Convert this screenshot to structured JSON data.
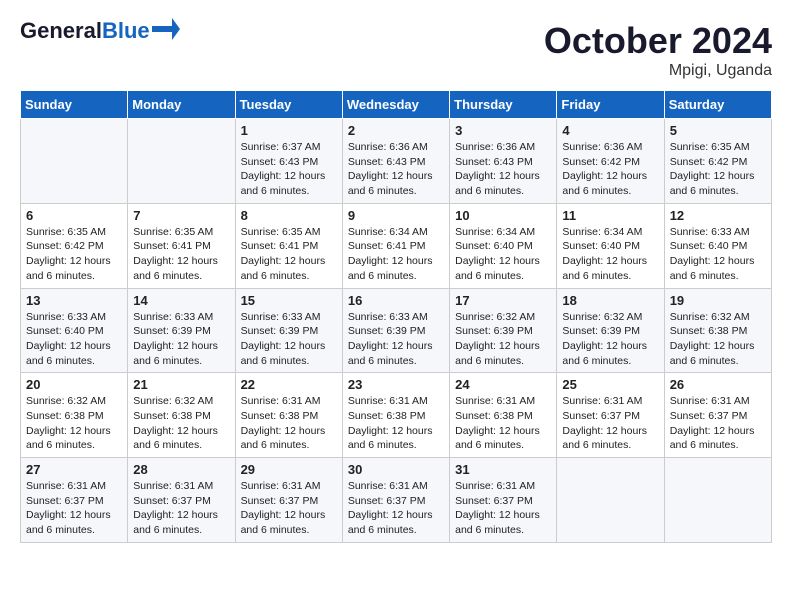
{
  "header": {
    "logo_line1": "General",
    "logo_line2": "Blue",
    "month": "October 2024",
    "location": "Mpigi, Uganda"
  },
  "weekdays": [
    "Sunday",
    "Monday",
    "Tuesday",
    "Wednesday",
    "Thursday",
    "Friday",
    "Saturday"
  ],
  "weeks": [
    [
      {
        "day": "",
        "info": ""
      },
      {
        "day": "",
        "info": ""
      },
      {
        "day": "1",
        "info": "Sunrise: 6:37 AM\nSunset: 6:43 PM\nDaylight: 12 hours\nand 6 minutes."
      },
      {
        "day": "2",
        "info": "Sunrise: 6:36 AM\nSunset: 6:43 PM\nDaylight: 12 hours\nand 6 minutes."
      },
      {
        "day": "3",
        "info": "Sunrise: 6:36 AM\nSunset: 6:43 PM\nDaylight: 12 hours\nand 6 minutes."
      },
      {
        "day": "4",
        "info": "Sunrise: 6:36 AM\nSunset: 6:42 PM\nDaylight: 12 hours\nand 6 minutes."
      },
      {
        "day": "5",
        "info": "Sunrise: 6:35 AM\nSunset: 6:42 PM\nDaylight: 12 hours\nand 6 minutes."
      }
    ],
    [
      {
        "day": "6",
        "info": "Sunrise: 6:35 AM\nSunset: 6:42 PM\nDaylight: 12 hours\nand 6 minutes."
      },
      {
        "day": "7",
        "info": "Sunrise: 6:35 AM\nSunset: 6:41 PM\nDaylight: 12 hours\nand 6 minutes."
      },
      {
        "day": "8",
        "info": "Sunrise: 6:35 AM\nSunset: 6:41 PM\nDaylight: 12 hours\nand 6 minutes."
      },
      {
        "day": "9",
        "info": "Sunrise: 6:34 AM\nSunset: 6:41 PM\nDaylight: 12 hours\nand 6 minutes."
      },
      {
        "day": "10",
        "info": "Sunrise: 6:34 AM\nSunset: 6:40 PM\nDaylight: 12 hours\nand 6 minutes."
      },
      {
        "day": "11",
        "info": "Sunrise: 6:34 AM\nSunset: 6:40 PM\nDaylight: 12 hours\nand 6 minutes."
      },
      {
        "day": "12",
        "info": "Sunrise: 6:33 AM\nSunset: 6:40 PM\nDaylight: 12 hours\nand 6 minutes."
      }
    ],
    [
      {
        "day": "13",
        "info": "Sunrise: 6:33 AM\nSunset: 6:40 PM\nDaylight: 12 hours\nand 6 minutes."
      },
      {
        "day": "14",
        "info": "Sunrise: 6:33 AM\nSunset: 6:39 PM\nDaylight: 12 hours\nand 6 minutes."
      },
      {
        "day": "15",
        "info": "Sunrise: 6:33 AM\nSunset: 6:39 PM\nDaylight: 12 hours\nand 6 minutes."
      },
      {
        "day": "16",
        "info": "Sunrise: 6:33 AM\nSunset: 6:39 PM\nDaylight: 12 hours\nand 6 minutes."
      },
      {
        "day": "17",
        "info": "Sunrise: 6:32 AM\nSunset: 6:39 PM\nDaylight: 12 hours\nand 6 minutes."
      },
      {
        "day": "18",
        "info": "Sunrise: 6:32 AM\nSunset: 6:39 PM\nDaylight: 12 hours\nand 6 minutes."
      },
      {
        "day": "19",
        "info": "Sunrise: 6:32 AM\nSunset: 6:38 PM\nDaylight: 12 hours\nand 6 minutes."
      }
    ],
    [
      {
        "day": "20",
        "info": "Sunrise: 6:32 AM\nSunset: 6:38 PM\nDaylight: 12 hours\nand 6 minutes."
      },
      {
        "day": "21",
        "info": "Sunrise: 6:32 AM\nSunset: 6:38 PM\nDaylight: 12 hours\nand 6 minutes."
      },
      {
        "day": "22",
        "info": "Sunrise: 6:31 AM\nSunset: 6:38 PM\nDaylight: 12 hours\nand 6 minutes."
      },
      {
        "day": "23",
        "info": "Sunrise: 6:31 AM\nSunset: 6:38 PM\nDaylight: 12 hours\nand 6 minutes."
      },
      {
        "day": "24",
        "info": "Sunrise: 6:31 AM\nSunset: 6:38 PM\nDaylight: 12 hours\nand 6 minutes."
      },
      {
        "day": "25",
        "info": "Sunrise: 6:31 AM\nSunset: 6:37 PM\nDaylight: 12 hours\nand 6 minutes."
      },
      {
        "day": "26",
        "info": "Sunrise: 6:31 AM\nSunset: 6:37 PM\nDaylight: 12 hours\nand 6 minutes."
      }
    ],
    [
      {
        "day": "27",
        "info": "Sunrise: 6:31 AM\nSunset: 6:37 PM\nDaylight: 12 hours\nand 6 minutes."
      },
      {
        "day": "28",
        "info": "Sunrise: 6:31 AM\nSunset: 6:37 PM\nDaylight: 12 hours\nand 6 minutes."
      },
      {
        "day": "29",
        "info": "Sunrise: 6:31 AM\nSunset: 6:37 PM\nDaylight: 12 hours\nand 6 minutes."
      },
      {
        "day": "30",
        "info": "Sunrise: 6:31 AM\nSunset: 6:37 PM\nDaylight: 12 hours\nand 6 minutes."
      },
      {
        "day": "31",
        "info": "Sunrise: 6:31 AM\nSunset: 6:37 PM\nDaylight: 12 hours\nand 6 minutes."
      },
      {
        "day": "",
        "info": ""
      },
      {
        "day": "",
        "info": ""
      }
    ]
  ]
}
